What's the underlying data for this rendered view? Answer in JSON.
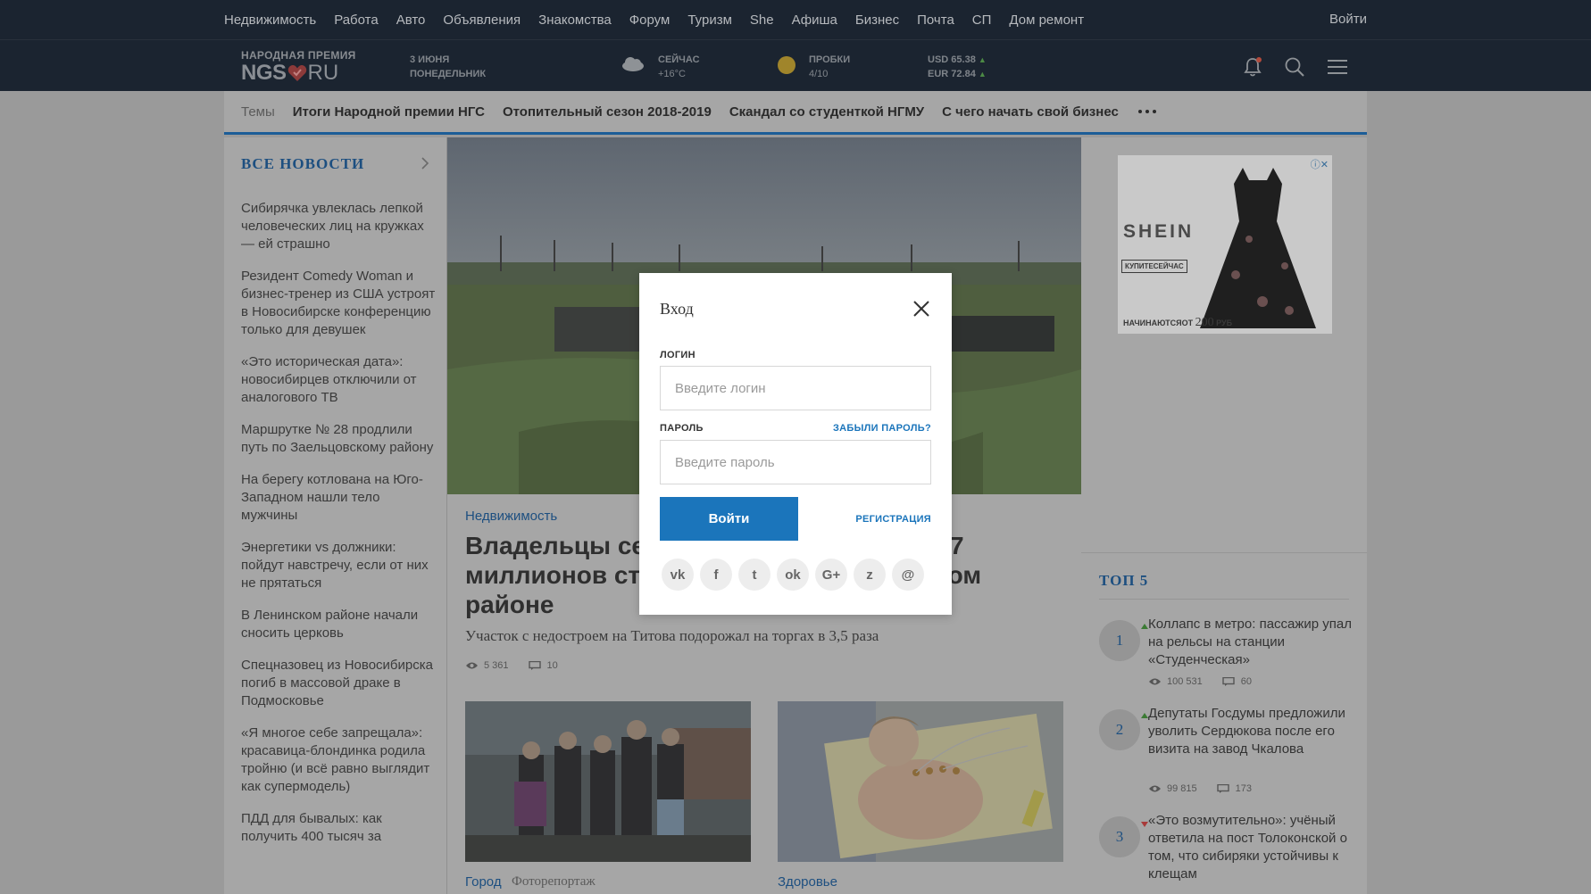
{
  "topnav": {
    "items": [
      "Недвижимость",
      "Работа",
      "Авто",
      "Объявления",
      "Знакомства",
      "Форум",
      "Туризм",
      "She",
      "Афиша",
      "Бизнес",
      "Почта",
      "СП",
      "Дом ремонт"
    ],
    "login": "Войти"
  },
  "header": {
    "logo_sub": "НАРОДНАЯ ПРЕМИЯ",
    "logo_ngs": "NGS",
    "logo_ru": "RU",
    "date_line1": "3 ИЮНЯ",
    "date_line2": "ПОНЕДЕЛЬНИК",
    "weather_label": "СЕЙЧАС",
    "weather_value": "+16°C",
    "traffic_label": "ПРОБКИ",
    "traffic_value": "4/10",
    "usd": "USD 65.38",
    "eur": "EUR 72.84",
    "up_glyph": "▲"
  },
  "themes": {
    "label": "Темы",
    "items": [
      "Итоги Народной премии НГС",
      "Отопительный сезон 2018-2019",
      "Скандал со студенткой НГМУ",
      "С чего начать свой бизнес"
    ]
  },
  "sidebar": {
    "title": "ВСЕ НОВОСТИ",
    "news": [
      "Сибирячка увлеклась лепкой человеческих лиц на кружках — ей страшно",
      "Резидент Comedy Woman и бизнес-тренер из США устроят в Новосибирске конференцию только для девушек",
      "«Это историческая дата»: новосибирцев отключили от аналогового ТВ",
      "Маршрутке № 28 продлили путь по Заельцовскому району",
      "На берегу котлована на Юго-Западном нашли тело мужчины",
      "Энергетики vs должники: пойдут навстречу, если от них не прятаться",
      "В Ленинском районе начали сносить церковь",
      "Спецназовец из Новосибирска погиб в массовой драке в Подмосковье",
      "«Я многое себе запрещала»: красавица-блондинка родила тройню (и всё равно выглядит как супермодель)",
      "ПДД для бывалых: как получить 400 тысяч за"
    ]
  },
  "main": {
    "category": "Недвижимость",
    "title_line1": "Владельцы сет",
    "title_line1_tail": "7",
    "title_line2": "миллионов ста",
    "title_line2_tail": "ком",
    "title_line3": "районе",
    "subtitle": "Участок с недостроем на Титова подорожал на торгах в 3,5 раза",
    "views": "5 361",
    "comments": "10",
    "card1_cat": "Город",
    "card1_cat2": "Фоторепортаж",
    "card2_cat": "Здоровье"
  },
  "ad": {
    "brand": "SHEIN",
    "buy": "КУПИТЕСЕЙЧАС",
    "from_prefix": "НАЧИНАЮТСЯОТ",
    "from_price": "200",
    "from_suffix": "РУБ",
    "close": "ⓘ✕"
  },
  "top5": {
    "title": "ТОП 5",
    "items": [
      {
        "num": "1",
        "title": "Коллапс в метро: пассажир упал на рельсы на станции «Студенческая»",
        "views": "100 531",
        "comments": "60",
        "trend": "up"
      },
      {
        "num": "2",
        "title": "Депутаты Госдумы предложили уволить Сердюкова после его визита на завод Чкалова",
        "views": "99 815",
        "comments": "173",
        "trend": "up"
      },
      {
        "num": "3",
        "title": "«Это возмутительно»: учёный ответила на пост Толоконской о том, что сибиряки устойчивы к клещам",
        "trend": "down"
      }
    ]
  },
  "modal": {
    "title": "Вход",
    "login_label": "ЛОГИН",
    "login_placeholder": "Введите логин",
    "password_label": "ПАРОЛЬ",
    "forgot": "ЗАБЫЛИ ПАРОЛЬ?",
    "password_placeholder": "Введите пароль",
    "submit": "Войти",
    "register": "РЕГИСТРАЦИЯ",
    "socials": [
      {
        "name": "vk-icon",
        "glyph": "vk"
      },
      {
        "name": "facebook-icon",
        "glyph": "f"
      },
      {
        "name": "twitter-icon",
        "glyph": "t"
      },
      {
        "name": "odnoklassniki-icon",
        "glyph": "ok"
      },
      {
        "name": "google-plus-icon",
        "glyph": "G+"
      },
      {
        "name": "zen-icon",
        "glyph": "z"
      },
      {
        "name": "mail-icon",
        "glyph": "@"
      }
    ]
  },
  "colors": {
    "header_bg": "#1b2430",
    "accent_blue": "#1b75bb",
    "link_dim": "#1d4f80"
  }
}
